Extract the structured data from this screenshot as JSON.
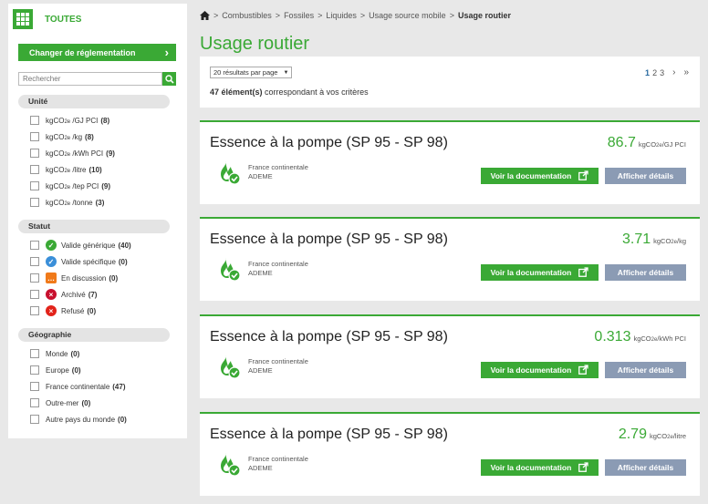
{
  "sidebar": {
    "logo_text": "TOUTES",
    "reg_button": "Changer de réglementation",
    "search_placeholder": "Rechercher",
    "unit": {
      "title": "Unité",
      "items": [
        {
          "pre": "kgCO",
          "sub": "2e",
          "post": " /GJ PCI",
          "count": "(8)"
        },
        {
          "pre": "kgCO",
          "sub": "2e",
          "post": " /kg",
          "count": "(8)"
        },
        {
          "pre": "kgCO",
          "sub": "2e",
          "post": " /kWh PCI",
          "count": "(9)"
        },
        {
          "pre": "kgCO",
          "sub": "2e",
          "post": " /litre",
          "count": "(10)"
        },
        {
          "pre": "kgCO",
          "sub": "2e",
          "post": " /tep PCI",
          "count": "(9)"
        },
        {
          "pre": "kgCO",
          "sub": "2e",
          "post": " /tonne",
          "count": "(3)"
        }
      ]
    },
    "status": {
      "title": "Statut",
      "items": [
        {
          "label": "Valide générique",
          "count": "(40)",
          "icon": "check-circle-icon",
          "color": "#3aa935",
          "glyph": "✓"
        },
        {
          "label": "Valide spécifique",
          "count": "(0)",
          "icon": "check-circle-icon",
          "color": "#3a8fd9",
          "glyph": "✓"
        },
        {
          "label": "En discussion",
          "count": "(0)",
          "icon": "chat-bubble-icon",
          "color": "#f07a1a",
          "glyph": "…"
        },
        {
          "label": "Archivé",
          "count": "(7)",
          "icon": "archive-x-icon",
          "color": "#c8102e",
          "glyph": "×"
        },
        {
          "label": "Refusé",
          "count": "(0)",
          "icon": "refused-x-icon",
          "color": "#e2231a",
          "glyph": "×"
        }
      ]
    },
    "geo": {
      "title": "Géographie",
      "items": [
        {
          "label": "Monde",
          "count": "(0)"
        },
        {
          "label": "Europe",
          "count": "(0)"
        },
        {
          "label": "France continentale",
          "count": "(47)"
        },
        {
          "label": "Outre-mer",
          "count": "(0)"
        },
        {
          "label": "Autre pays du monde",
          "count": "(0)"
        }
      ]
    }
  },
  "breadcrumb": [
    "Combustibles",
    "Fossiles",
    "Liquides",
    "Usage source mobile",
    "Usage routier"
  ],
  "page_title": "Usage routier",
  "results": {
    "per_page": "20 résultats par page",
    "count_bold": "47 élément(s)",
    "count_rest": " correspondant à vos critères",
    "pages": [
      "1",
      "2",
      "3"
    ],
    "next": "›",
    "last": "»"
  },
  "cards": [
    {
      "title": "Essence à la pompe (SP 95 - SP 98)",
      "value": "86.7",
      "unit_pre": "kgCO",
      "unit_sub": "2e",
      "unit_post": "/GJ PCI",
      "geo": "France continentale",
      "source": "ADEME",
      "doc_label": "Voir la documentation",
      "detail_label": "Afficher détails"
    },
    {
      "title": "Essence à la pompe (SP 95 - SP 98)",
      "value": "3.71",
      "unit_pre": "kgCO",
      "unit_sub": "2e",
      "unit_post": "/kg",
      "geo": "France continentale",
      "source": "ADEME",
      "doc_label": "Voir la documentation",
      "detail_label": "Afficher détails"
    },
    {
      "title": "Essence à la pompe (SP 95 - SP 98)",
      "value": "0.313",
      "unit_pre": "kgCO",
      "unit_sub": "2e",
      "unit_post": "/kWh PCI",
      "geo": "France continentale",
      "source": "ADEME",
      "doc_label": "Voir la documentation",
      "detail_label": "Afficher détails"
    },
    {
      "title": "Essence à la pompe (SP 95 - SP 98)",
      "value": "2.79",
      "unit_pre": "kgCO",
      "unit_sub": "2e",
      "unit_post": "/litre",
      "geo": "France continentale",
      "source": "ADEME",
      "doc_label": "Voir la documentation",
      "detail_label": "Afficher détails"
    }
  ],
  "colors": {
    "accent": "#3aa935",
    "details_button": "#8b9bb4",
    "pager_active": "#2a6aa0"
  }
}
